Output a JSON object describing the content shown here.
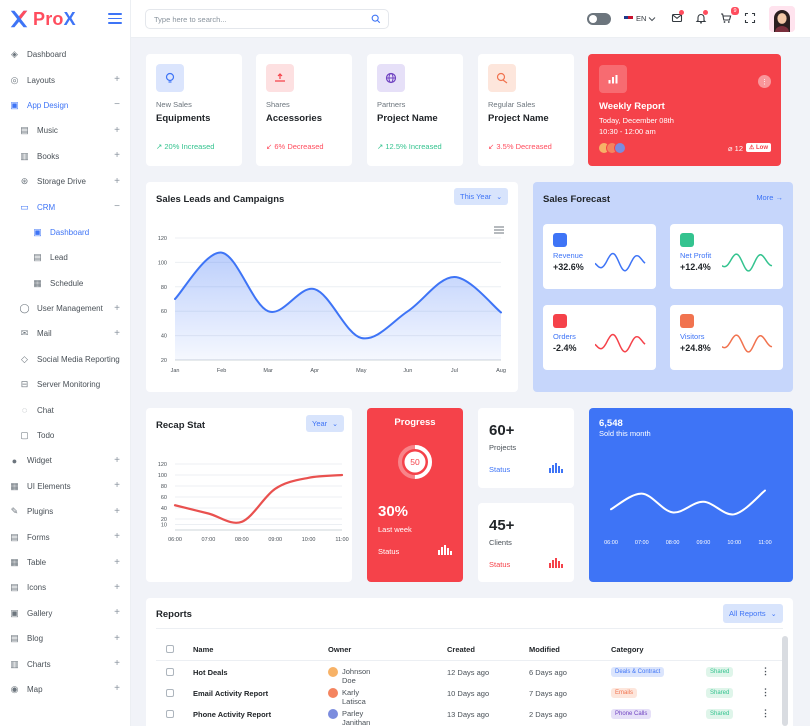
{
  "app": {
    "logo_a": "Pro",
    "logo_b": "X"
  },
  "topbar": {
    "search_placeholder": "Type here to search...",
    "language": "EN",
    "cart_count": "9"
  },
  "sidebar": {
    "items": [
      {
        "label": "Dashboard",
        "icon": "dashboard-icon",
        "level": 0,
        "toggle": ""
      },
      {
        "label": "Layouts",
        "icon": "layouts-icon",
        "level": 0,
        "toggle": "+"
      },
      {
        "label": "App Design",
        "icon": "app-design-icon",
        "level": 0,
        "toggle": "−",
        "active": true
      },
      {
        "label": "Music",
        "icon": "music-icon",
        "level": 1,
        "toggle": "+"
      },
      {
        "label": "Books",
        "icon": "book-icon",
        "level": 1,
        "toggle": "+"
      },
      {
        "label": "Storage Drive",
        "icon": "storage-icon",
        "level": 1,
        "toggle": "+"
      },
      {
        "label": "CRM",
        "icon": "crm-icon",
        "level": 1,
        "toggle": "−",
        "active": true
      },
      {
        "label": "Dashboard",
        "icon": "crm-dashboard-icon",
        "level": 2,
        "toggle": "",
        "active": true
      },
      {
        "label": "Lead",
        "icon": "lead-icon",
        "level": 2,
        "toggle": ""
      },
      {
        "label": "Schedule",
        "icon": "schedule-icon",
        "level": 2,
        "toggle": ""
      },
      {
        "label": "User Management",
        "icon": "user-icon",
        "level": 1,
        "toggle": "+"
      },
      {
        "label": "Mail",
        "icon": "mail-icon",
        "level": 1,
        "toggle": "+"
      },
      {
        "label": "Social Media Reporting",
        "icon": "social-icon",
        "level": 1,
        "toggle": ""
      },
      {
        "label": "Server Monitoring",
        "icon": "server-icon",
        "level": 1,
        "toggle": ""
      },
      {
        "label": "Chat",
        "icon": "chat-icon",
        "level": 1,
        "toggle": ""
      },
      {
        "label": "Todo",
        "icon": "todo-icon",
        "level": 1,
        "toggle": ""
      },
      {
        "label": "Widget",
        "icon": "widget-icon",
        "level": 0,
        "toggle": "+"
      },
      {
        "label": "UI Elements",
        "icon": "ui-elements-icon",
        "level": 0,
        "toggle": "+"
      },
      {
        "label": "Plugins",
        "icon": "plugins-icon",
        "level": 0,
        "toggle": "+"
      },
      {
        "label": "Forms",
        "icon": "forms-icon",
        "level": 0,
        "toggle": "+"
      },
      {
        "label": "Table",
        "icon": "table-icon",
        "level": 0,
        "toggle": "+"
      },
      {
        "label": "Icons",
        "icon": "icons-icon",
        "level": 0,
        "toggle": "+"
      },
      {
        "label": "Gallery",
        "icon": "gallery-icon",
        "level": 0,
        "toggle": "+"
      },
      {
        "label": "Blog",
        "icon": "blog-icon",
        "level": 0,
        "toggle": "+"
      },
      {
        "label": "Charts",
        "icon": "charts-icon",
        "level": 0,
        "toggle": "+"
      },
      {
        "label": "Map",
        "icon": "map-icon",
        "level": 0,
        "toggle": "+"
      }
    ]
  },
  "stats": [
    {
      "t1": "New Sales",
      "t2": "Equipments",
      "t3": "20% Increased",
      "trend": "up",
      "color": "#3e74f6",
      "bg": "#dbe5fd",
      "icon": "bulb-icon"
    },
    {
      "t1": "Shares",
      "t2": "Accessories",
      "t3": "6% Decreased",
      "trend": "down",
      "color": "#f5424a",
      "bg": "#fde0e1",
      "icon": "hand-icon"
    },
    {
      "t1": "Partners",
      "t2": "Project Name",
      "t3": "12.5% Increased",
      "trend": "up",
      "color": "#6f42c1",
      "bg": "#e6e0f8",
      "icon": "globe-icon"
    },
    {
      "t1": "Regular Sales",
      "t2": "Project Name",
      "t3": "3.5% Decreased",
      "trend": "down",
      "color": "#f1734f",
      "bg": "#fde6dc",
      "icon": "money-icon"
    }
  ],
  "weekly": {
    "title": "Weekly Report",
    "date": "Today, December 08th",
    "time": "10:30 - 12:00 am",
    "attachments": "12",
    "priority": "Low"
  },
  "leads": {
    "title": "Sales Leads and Campaigns",
    "filter": "This Year"
  },
  "forecast": {
    "title": "Sales Forecast",
    "more": "More",
    "cards": [
      {
        "label": "Revenue",
        "value": "+32.6%",
        "color": "#3e74f6",
        "icon": "revenue-icon"
      },
      {
        "label": "Net Profit",
        "value": "+12.4%",
        "color": "#34c38f",
        "icon": "profit-icon"
      },
      {
        "label": "Orders",
        "value": "-2.4%",
        "color": "#f5424a",
        "icon": "orders-icon"
      },
      {
        "label": "Visitors",
        "value": "+24.8%",
        "color": "#f1734f",
        "icon": "visitors-icon"
      }
    ]
  },
  "recap": {
    "title": "Recap Stat",
    "filter": "Year"
  },
  "progress": {
    "title": "Progress",
    "ring_value": "50",
    "ring_fraction": 0.5,
    "percent": "30%",
    "period": "Last week",
    "status": "Status"
  },
  "projects": {
    "value": "60+",
    "label": "Projects",
    "status": "Status"
  },
  "clients": {
    "value": "45+",
    "label": "Clients",
    "status": "Status"
  },
  "sold": {
    "value": "6,548",
    "label": "Sold this month"
  },
  "reports": {
    "title": "Reports",
    "filter": "All Reports",
    "headers": [
      "Name",
      "Owner",
      "Created",
      "Modified",
      "Category"
    ],
    "rows": [
      {
        "name": "Hot Deals",
        "owner": "Johnson Doe",
        "created": "12 Days ago",
        "modified": "6 Days ago",
        "category": "Deals & Contract",
        "cat_color": "#3e74f6",
        "cat_bg": "#dbe5fd",
        "status": "Shared"
      },
      {
        "name": "Email Activity Report",
        "owner": "Karly Latisca",
        "created": "10 Days ago",
        "modified": "7 Days ago",
        "category": "Emails",
        "cat_color": "#f1734f",
        "cat_bg": "#fde6dc",
        "status": "Shared"
      },
      {
        "name": "Phone Activity Report",
        "owner": "Parley Janithan",
        "created": "13 Days ago",
        "modified": "2 Days ago",
        "category": "Phone Calls",
        "cat_color": "#6f42c1",
        "cat_bg": "#e6e0f8",
        "status": "Shared"
      }
    ]
  },
  "chart_data": [
    {
      "type": "area",
      "categories": [
        "Jan",
        "Feb",
        "Mar",
        "Apr",
        "May",
        "Jun",
        "Jul",
        "Aug"
      ],
      "series": [
        {
          "values": [
            70,
            108,
            60,
            78,
            38,
            60,
            88,
            59
          ]
        }
      ],
      "yticks": [
        20,
        40,
        60,
        80,
        100,
        120
      ],
      "ylim": [
        20,
        120
      ],
      "grid": true,
      "color": "#3e74f6"
    },
    {
      "type": "line",
      "categories": [
        "06:00",
        "07:00",
        "08:00",
        "09:00",
        "10:00",
        "11:00"
      ],
      "series": [
        {
          "values": [
            45,
            30,
            15,
            75,
            95,
            100
          ]
        }
      ],
      "yticks": [
        10,
        20,
        40,
        60,
        80,
        100,
        120
      ],
      "ylim": [
        0,
        120
      ],
      "color": "#e9514f"
    },
    {
      "type": "line",
      "categories": [
        "06:00",
        "07:00",
        "08:00",
        "09:00",
        "10:00",
        "11:00"
      ],
      "series": [
        {
          "values": [
            30,
            55,
            25,
            42,
            22,
            60
          ]
        }
      ],
      "ylim": [
        0,
        80
      ],
      "color": "#ffffff"
    }
  ]
}
